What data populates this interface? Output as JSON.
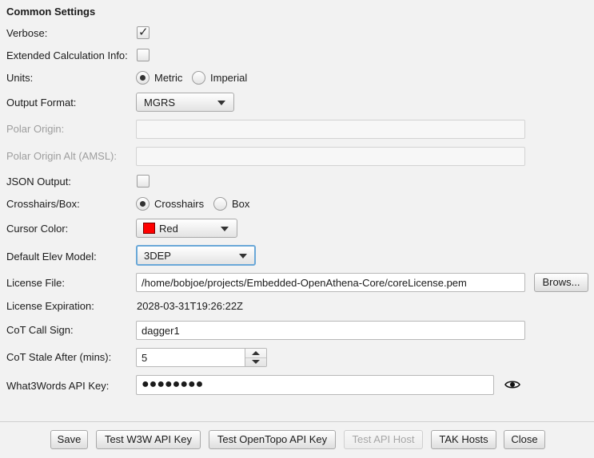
{
  "section_title": "Common Settings",
  "rows": {
    "verbose": {
      "label": "Verbose:",
      "checked": true
    },
    "extended_calc": {
      "label": "Extended Calculation Info:",
      "checked": false
    },
    "units": {
      "label": "Units:",
      "options": [
        "Metric",
        "Imperial"
      ],
      "selected": "Metric"
    },
    "output_format": {
      "label": "Output Format:",
      "value": "MGRS"
    },
    "polar_origin": {
      "label": "Polar Origin:",
      "value": ""
    },
    "polar_origin_alt": {
      "label": "Polar Origin Alt (AMSL):",
      "value": ""
    },
    "json_output": {
      "label": "JSON Output:",
      "checked": false
    },
    "crosshairs": {
      "label": "Crosshairs/Box:",
      "options": [
        "Crosshairs",
        "Box"
      ],
      "selected": "Crosshairs"
    },
    "cursor_color": {
      "label": "Cursor Color:",
      "value": "Red",
      "swatch": "#ff0000"
    },
    "elev_model": {
      "label": "Default Elev Model:",
      "value": "3DEP"
    },
    "license_file": {
      "label": "License File:",
      "value": "/home/bobjoe/projects/Embedded-OpenAthena-Core/coreLicense.pem",
      "browse_label": "Brows..."
    },
    "license_expiration": {
      "label": "License Expiration:",
      "value": "2028-03-31T19:26:22Z"
    },
    "cot_call_sign": {
      "label": "CoT Call Sign:",
      "value": "dagger1"
    },
    "cot_stale": {
      "label": "CoT Stale After (mins):",
      "value": "5"
    },
    "w3w_key": {
      "label": "What3Words API Key:",
      "value": "●●●●●●●●",
      "icon": "eye-icon"
    }
  },
  "footer": {
    "save": "Save",
    "test_w3w": "Test W3W API Key",
    "test_opentopo": "Test OpenTopo API Key",
    "test_api_host": "Test API Host",
    "tak_hosts": "TAK Hosts",
    "close": "Close"
  }
}
